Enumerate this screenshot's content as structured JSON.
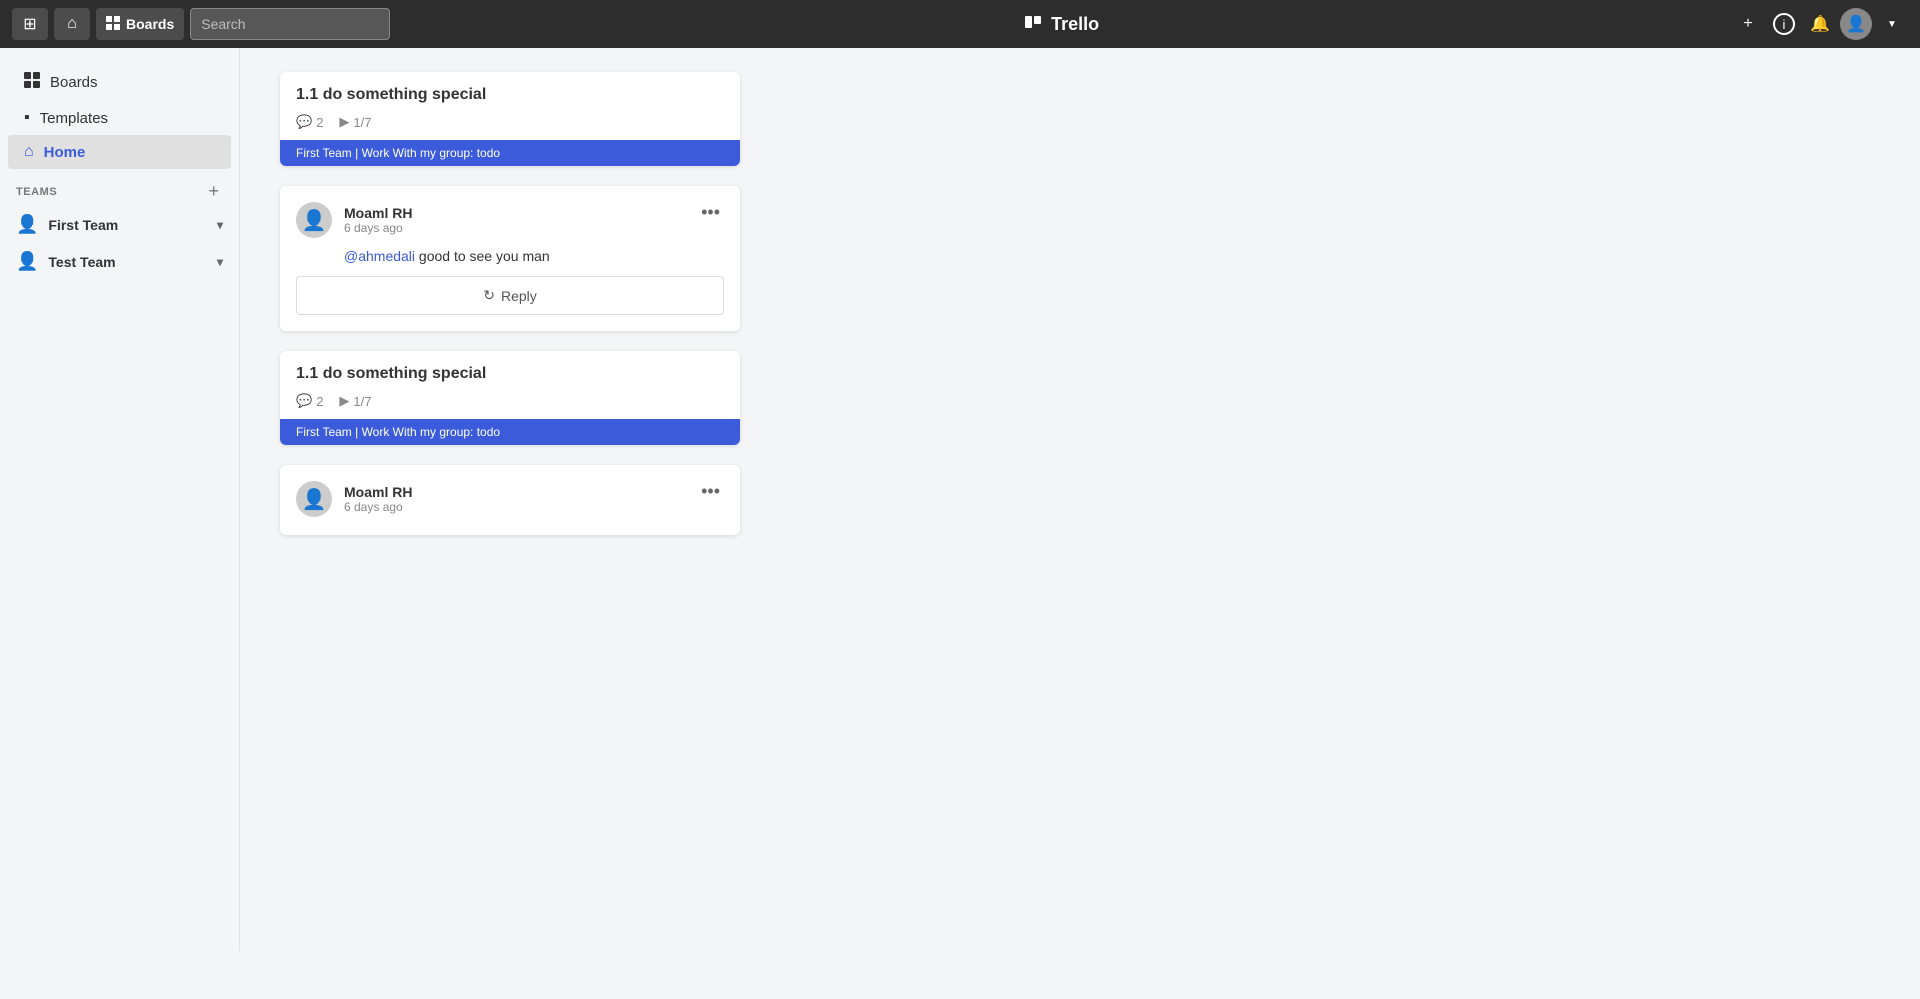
{
  "topbar": {
    "apps_label": "⊞",
    "home_label": "⌂",
    "boards_label": "Boards",
    "search_placeholder": "Search",
    "title": "Trello",
    "title_icon": "⊞",
    "add_label": "+",
    "info_label": "ℹ",
    "bell_label": "🔔",
    "avatar_label": "👤"
  },
  "sidebar": {
    "boards_label": "Boards",
    "boards_icon": "⊞",
    "templates_label": "Templates",
    "templates_icon": "▪",
    "home_label": "Home",
    "home_icon": "⌂",
    "teams_section": "Teams",
    "first_team_label": "First Team",
    "test_team_label": "Test Team",
    "team_icon": "👤"
  },
  "cards": [
    {
      "title": "1.1 do something special",
      "comments_count": "2",
      "checklist": "1/7",
      "footer": "First Team | Work With my group: todo"
    },
    {
      "title": "1.1 do something special",
      "comments_count": "2",
      "checklist": "1/7",
      "footer": "First Team | Work With my group: todo"
    }
  ],
  "comment": {
    "username": "Moaml RH",
    "time": "6 days ago",
    "mention": "@ahmedali",
    "text": " good to see you man",
    "reply_label": "Reply",
    "more_icon": "•••"
  },
  "comment2": {
    "username": "Moaml RH",
    "time": "6 days ago"
  }
}
